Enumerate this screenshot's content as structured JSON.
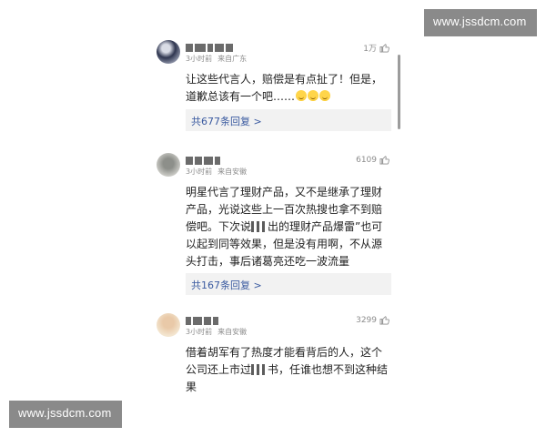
{
  "watermark": {
    "text": "www.jssdcm.com"
  },
  "comments": [
    {
      "likes": "1万",
      "time": "3小时前",
      "location": "来自广东",
      "text": "让这些代言人，赔偿是有点扯了！但是，道歉总该有一个吧……",
      "emojis": [
        "smile-emoji",
        "smile-emoji",
        "smile-emoji"
      ],
      "replies": "共677条回复 >"
    },
    {
      "likes": "6109",
      "time": "3小时前",
      "location": "来自安徽",
      "text_before": "明星代言了理财产品，又不是继承了理财产品，光说这些上一百次热搜也拿不到赔偿吧。下次说",
      "text_after": "出的理财产品爆雷”也可以起到同等效果，但是没有用啊，不从源头打击，事后诸葛亮还吃一波流量",
      "replies": "共167条回复 >"
    },
    {
      "likes": "3299",
      "time": "3小时前",
      "location": "来自安徽",
      "text_before": "借着胡军有了热度才能看背后的人，这个公司还上市过",
      "text_after": "书，任谁也想不到这种结果"
    }
  ],
  "colors": {
    "reply_link": "#3a5aa0",
    "reply_bg": "#f2f2f2",
    "meta": "#8c8c8c",
    "watermark_bg": "#8a8a8a"
  }
}
